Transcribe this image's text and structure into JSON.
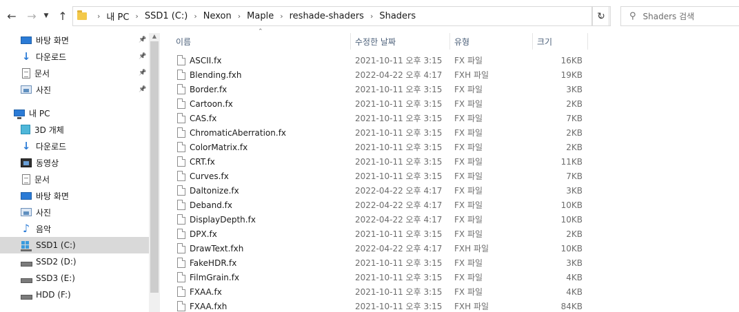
{
  "breadcrumb": [
    "내 PC",
    "SSD1 (C:)",
    "Nexon",
    "Maple",
    "reshade-shaders",
    "Shaders"
  ],
  "search_placeholder": "Shaders 검색",
  "sidebar": {
    "quick_access": [
      {
        "label": "바탕 화면",
        "icon": "desktop-icon",
        "pinned": true
      },
      {
        "label": "다운로드",
        "icon": "download-icon",
        "pinned": true
      },
      {
        "label": "문서",
        "icon": "document-icon",
        "pinned": true
      },
      {
        "label": "사진",
        "icon": "pictures-icon",
        "pinned": true
      }
    ],
    "this_pc_label": "내 PC",
    "this_pc_items": [
      {
        "label": "3D 개체",
        "icon": "3d-objects-icon"
      },
      {
        "label": "다운로드",
        "icon": "download-icon"
      },
      {
        "label": "동영상",
        "icon": "video-icon"
      },
      {
        "label": "문서",
        "icon": "document-icon"
      },
      {
        "label": "바탕 화면",
        "icon": "desktop-icon"
      },
      {
        "label": "사진",
        "icon": "pictures-icon"
      },
      {
        "label": "음악",
        "icon": "music-icon"
      },
      {
        "label": "SSD1 (C:)",
        "icon": "windows-drive-icon",
        "selected": true
      },
      {
        "label": "SSD2 (D:)",
        "icon": "drive-icon"
      },
      {
        "label": "SSD3 (E:)",
        "icon": "drive-icon"
      },
      {
        "label": "HDD (F:)",
        "icon": "drive-icon"
      }
    ]
  },
  "columns": {
    "name": "이름",
    "date": "수정한 날짜",
    "type": "유형",
    "size": "크기"
  },
  "files": [
    {
      "name": "ASCII.fx",
      "date": "2021-10-11 오후 3:15",
      "type": "FX 파일",
      "size": "16KB"
    },
    {
      "name": "Blending.fxh",
      "date": "2022-04-22 오후 4:17",
      "type": "FXH 파일",
      "size": "19KB"
    },
    {
      "name": "Border.fx",
      "date": "2021-10-11 오후 3:15",
      "type": "FX 파일",
      "size": "3KB"
    },
    {
      "name": "Cartoon.fx",
      "date": "2021-10-11 오후 3:15",
      "type": "FX 파일",
      "size": "2KB"
    },
    {
      "name": "CAS.fx",
      "date": "2021-10-11 오후 3:15",
      "type": "FX 파일",
      "size": "7KB"
    },
    {
      "name": "ChromaticAberration.fx",
      "date": "2021-10-11 오후 3:15",
      "type": "FX 파일",
      "size": "2KB"
    },
    {
      "name": "ColorMatrix.fx",
      "date": "2021-10-11 오후 3:15",
      "type": "FX 파일",
      "size": "2KB"
    },
    {
      "name": "CRT.fx",
      "date": "2021-10-11 오후 3:15",
      "type": "FX 파일",
      "size": "11KB"
    },
    {
      "name": "Curves.fx",
      "date": "2021-10-11 오후 3:15",
      "type": "FX 파일",
      "size": "7KB"
    },
    {
      "name": "Daltonize.fx",
      "date": "2022-04-22 오후 4:17",
      "type": "FX 파일",
      "size": "3KB"
    },
    {
      "name": "Deband.fx",
      "date": "2022-04-22 오후 4:17",
      "type": "FX 파일",
      "size": "10KB"
    },
    {
      "name": "DisplayDepth.fx",
      "date": "2022-04-22 오후 4:17",
      "type": "FX 파일",
      "size": "10KB"
    },
    {
      "name": "DPX.fx",
      "date": "2021-10-11 오후 3:15",
      "type": "FX 파일",
      "size": "2KB"
    },
    {
      "name": "DrawText.fxh",
      "date": "2022-04-22 오후 4:17",
      "type": "FXH 파일",
      "size": "10KB"
    },
    {
      "name": "FakeHDR.fx",
      "date": "2021-10-11 오후 3:15",
      "type": "FX 파일",
      "size": "3KB"
    },
    {
      "name": "FilmGrain.fx",
      "date": "2021-10-11 오후 3:15",
      "type": "FX 파일",
      "size": "4KB"
    },
    {
      "name": "FXAA.fx",
      "date": "2021-10-11 오후 3:15",
      "type": "FX 파일",
      "size": "4KB"
    },
    {
      "name": "FXAA.fxh",
      "date": "2021-10-11 오후 3:15",
      "type": "FXH 파일",
      "size": "84KB"
    }
  ]
}
